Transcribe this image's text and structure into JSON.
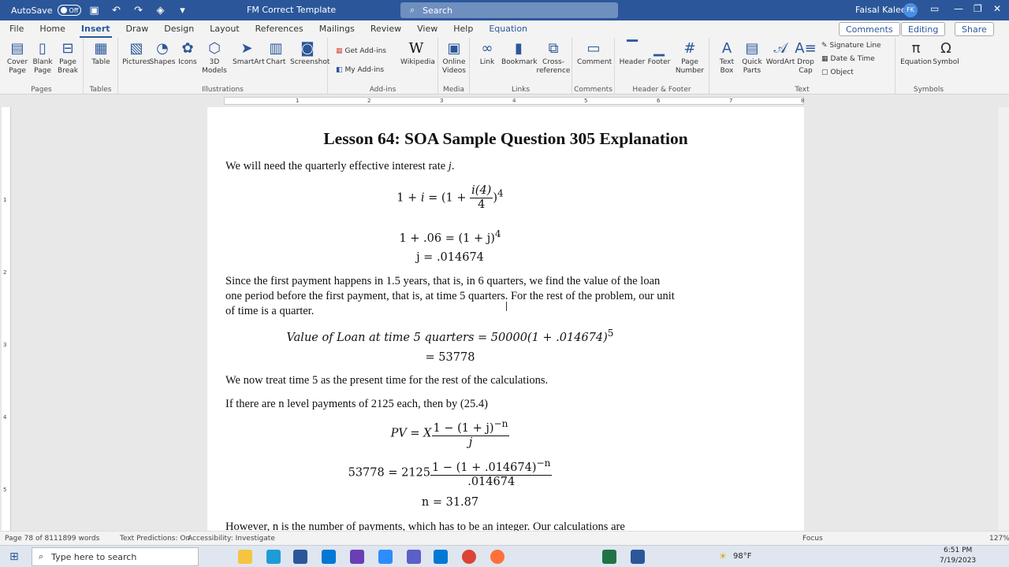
{
  "titlebar": {
    "autosave": "AutoSave",
    "autosave_state": "Off",
    "doc_title": "FM Correct Template",
    "search_placeholder": "Search",
    "user": "Faisal Kaleem",
    "initials": "FK"
  },
  "menu": {
    "tabs": [
      "File",
      "Home",
      "Insert",
      "Draw",
      "Design",
      "Layout",
      "References",
      "Mailings",
      "Review",
      "View",
      "Help",
      "Equation"
    ],
    "active": "Insert",
    "comments": "Comments",
    "editing": "Editing",
    "share": "Share"
  },
  "ribbon": {
    "groups": {
      "pages": "Pages",
      "tables": "Tables",
      "illustrations": "Illustrations",
      "addins": "Add-ins",
      "media": "Media",
      "links": "Links",
      "comments": "Comments",
      "header_footer": "Header & Footer",
      "text": "Text",
      "symbols": "Symbols"
    },
    "pages": {
      "cover": "Cover Page",
      "blank": "Blank Page",
      "break": "Page Break"
    },
    "table": "Table",
    "illus": {
      "pictures": "Pictures",
      "shapes": "Shapes",
      "icons": "Icons",
      "models": "3D Models",
      "smartart": "SmartArt",
      "chart": "Chart",
      "screenshot": "Screenshot"
    },
    "addins": {
      "get": "Get Add-ins",
      "my": "My Add-ins",
      "wiki": "Wikipedia"
    },
    "media": "Online Videos",
    "links": {
      "link": "Link",
      "bookmark": "Bookmark",
      "cross": "Cross-reference"
    },
    "comment": "Comment",
    "hf": {
      "header": "Header",
      "footer": "Footer",
      "pagenum": "Page Number"
    },
    "text": {
      "textbox": "Text Box",
      "quick": "Quick Parts",
      "wordart": "WordArt",
      "dropcap": "Drop Cap",
      "sig": "Signature Line",
      "date": "Date & Time",
      "object": "Object"
    },
    "symbols": {
      "equation": "Equation",
      "symbol": "Symbol"
    }
  },
  "ruler": {
    "ticks": [
      "1",
      "2",
      "3",
      "4",
      "5",
      "6",
      "7",
      "8"
    ],
    "vticks": [
      "1",
      "2",
      "3",
      "4",
      "5"
    ]
  },
  "doc": {
    "title": "Lesson 64:  SOA Sample Question 305 Explanation",
    "p1": "We will need the quarterly effective interest rate ",
    "p1_var": "j",
    "p1_end": ".",
    "eq1_lhs": "1 + ",
    "eq1_i": "i",
    "eq1_eq": " = (1 + ",
    "eq1_num": "i(4)",
    "eq1_den": "4",
    "eq1_rp": ")",
    "eq1_exp": "4",
    "eq2": "1 + .06 = (1 + j)",
    "eq2_exp": "4",
    "eq3": "j = .014674",
    "p2": "Since the first payment happens in 1.5 years, that is, in 6 quarters, we find the value of the loan one period before the first payment, that is, at time 5 quarters.  For the rest of the problem, our unit of time is a quarter.",
    "eq4": "Value of Loan at time 5 quarters = 50000(1 + .014674)",
    "eq4_exp": "5",
    "eq5": "= 53778",
    "p3": "We now treat time 5 as the present time for the rest of the calculations.",
    "p4": "If there are n level payments of 2125 each, then by (25.4)",
    "eq6_lhs": "PV = X",
    "eq6_num": "1 − (1 + j)",
    "eq6_num_exp": "−n",
    "eq6_den": "j",
    "eq7_lhs": "53778 = 2125",
    "eq7_num": "1 − (1 + .014674)",
    "eq7_num_exp": "−n",
    "eq7_den": ".014674",
    "eq8": "n = 31.87",
    "p5": "However, n is the number of payments, which has to be an integer.  Our calculations are"
  },
  "status": {
    "page": "Page 78 of 81",
    "words": "11899 words",
    "predictions": "Text Predictions: On",
    "access": "Accessibility: Investigate",
    "focus": "Focus",
    "zoom": "127%"
  },
  "taskbar": {
    "search": "Type here to search",
    "temp": "98°F",
    "time": "6:51 PM",
    "date": "7/19/2023"
  }
}
